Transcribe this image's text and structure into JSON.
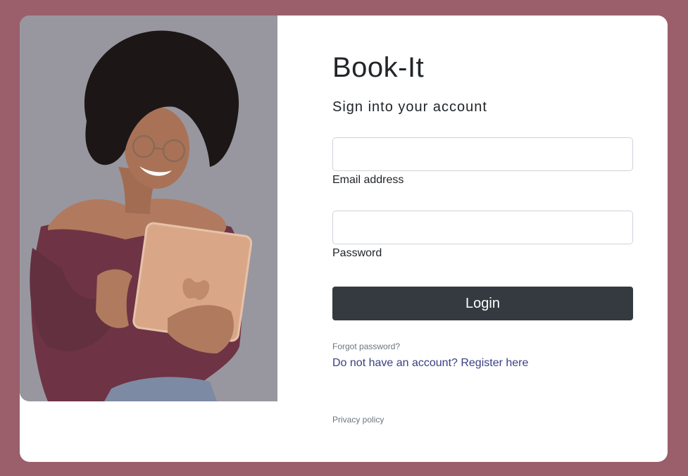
{
  "brand": {
    "title": "Book-It"
  },
  "form": {
    "subtitle": "Sign into your account",
    "email": {
      "label": "Email address",
      "value": "",
      "placeholder": ""
    },
    "password": {
      "label": "Password",
      "value": "",
      "placeholder": ""
    },
    "login_label": "Login"
  },
  "links": {
    "forgot_password": "Forgot password?",
    "register": "Do not have an account? Register here",
    "privacy": "Privacy policy"
  },
  "colors": {
    "page_background": "#9a5f6b",
    "card_background": "#ffffff",
    "login_button": "#343a40",
    "register_link": "#393f81",
    "muted_link": "#6c757d"
  },
  "image": {
    "icon": "woman-with-tablet-photo"
  }
}
